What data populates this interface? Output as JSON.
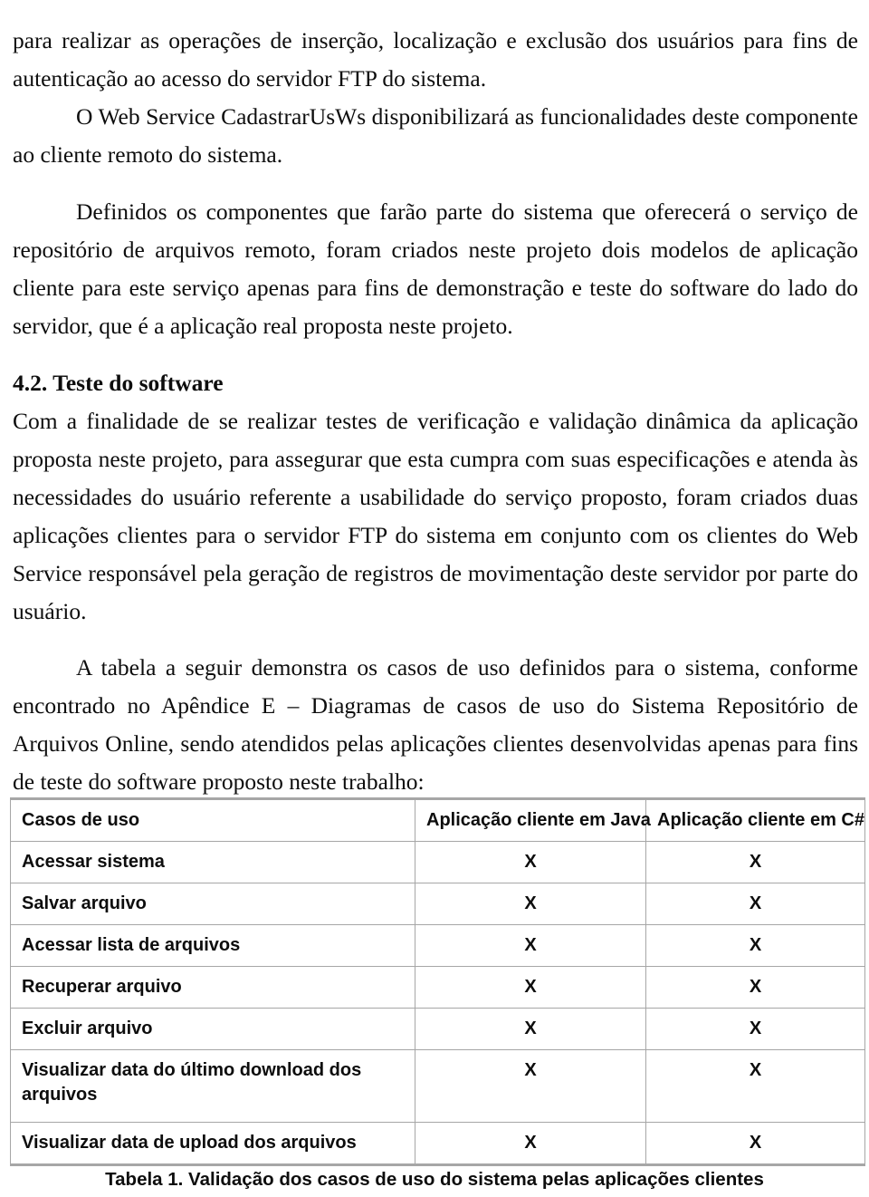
{
  "document": {
    "paragraphs": [
      {
        "id": "p1",
        "text": "para realizar as operações de inserção, localização e exclusão dos usuários para fins de autenticação ao acesso do servidor FTP do sistema.",
        "indented": false
      },
      {
        "id": "p2",
        "text": "O Web Service CadastrarUsWs disponibilizará as funcionalidades deste componente ao cliente remoto do sistema.",
        "indented": true
      },
      {
        "id": "p3",
        "text": "Definidos os componentes que farão parte do sistema que oferecerá o serviço de repositório de arquivos remoto, foram criados neste projeto dois modelos de aplicação cliente para este serviço apenas para fins de demonstração e teste do software do lado do servidor, que é a aplicação real proposta neste projeto.",
        "indented": true
      },
      {
        "id": "p4",
        "text": "Com a finalidade de se realizar testes de verificação e validação dinâmica da aplicação proposta neste projeto, para assegurar que esta cumpra com suas especificações e atenda às necessidades do usuário referente a usabilidade do serviço proposto, foram criados duas aplicações clientes para o servidor FTP do sistema em conjunto com os clientes do Web Service responsável pela geração de registros de movimentação deste servidor por parte do usuário.",
        "indented": false
      },
      {
        "id": "p5",
        "text": "A tabela a seguir demonstra os casos de uso definidos para o sistema, conforme encontrado no Apêndice E – Diagramas de casos de uso do Sistema Repositório de Arquivos Online, sendo atendidos pelas aplicações clientes desenvolvidas apenas para fins de teste do software proposto neste trabalho:",
        "indented": true
      }
    ],
    "heading": {
      "number": "4.2.",
      "title": "Teste do software",
      "full": "4.2. Teste do software"
    },
    "table": {
      "columns": [
        "Casos de uso",
        "Aplicação cliente em Java",
        "Aplicação cliente em C#"
      ],
      "rows": [
        {
          "use_case": "Acessar sistema",
          "java": "X",
          "csharp": "X"
        },
        {
          "use_case": "Salvar arquivo",
          "java": "X",
          "csharp": "X"
        },
        {
          "use_case": "Acessar lista de arquivos",
          "java": "X",
          "csharp": "X"
        },
        {
          "use_case": "Recuperar arquivo",
          "java": "X",
          "csharp": "X"
        },
        {
          "use_case": "Excluir arquivo",
          "java": "X",
          "csharp": "X"
        },
        {
          "use_case": "Visualizar data do último download dos arquivos",
          "java": "X",
          "csharp": "X"
        },
        {
          "use_case": "Visualizar data de upload dos arquivos",
          "java": "X",
          "csharp": "X"
        }
      ],
      "caption": "Tabela 1. Validação dos casos de uso do sistema pelas aplicações clientes"
    },
    "colors": {
      "text": "#0d0d0d",
      "table_border": "#a6a6a6",
      "page_background": "#ffffff"
    }
  }
}
